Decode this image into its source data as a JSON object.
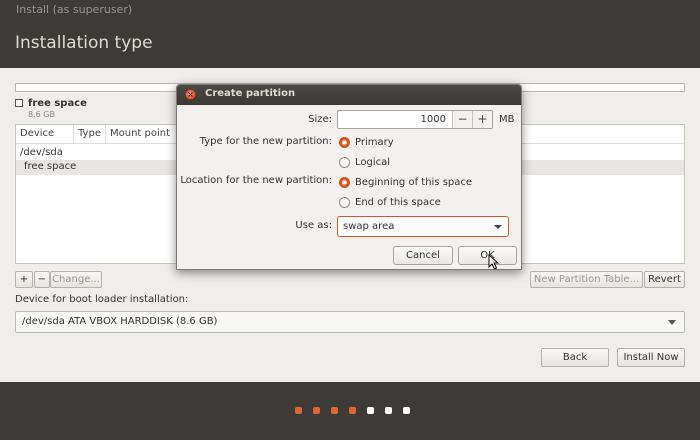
{
  "window": {
    "title": "Install (as superuser)",
    "page_title": "Installation type"
  },
  "disk_summary": {
    "label": "free space",
    "size": "8.6 GB"
  },
  "partition_table": {
    "columns": [
      "Device",
      "Type",
      "Mount point"
    ],
    "rows": [
      {
        "device": "/dev/sda"
      },
      {
        "device": "free space",
        "selected": true
      }
    ]
  },
  "table_actions": {
    "add": "+",
    "remove": "−",
    "change": "Change...",
    "new_table": "New Partition Table...",
    "revert": "Revert"
  },
  "boot_loader": {
    "label": "Device for boot loader installation:",
    "value": "/dev/sda ATA VBOX HARDDISK (8.6 GB)"
  },
  "nav": {
    "back": "Back",
    "install_now": "Install Now"
  },
  "progress": {
    "total": 7,
    "completed": 4,
    "active_color": "#e0662f",
    "inactive_color": "#ffffff"
  },
  "dialog": {
    "title": "Create partition",
    "close_icon": "close-icon",
    "size_label": "Size:",
    "size_value": "1000",
    "size_unit": "MB",
    "minus": "−",
    "plus": "+",
    "type_label": "Type for the new partition:",
    "type_options": [
      {
        "label": "Primary",
        "selected": true
      },
      {
        "label": "Logical",
        "selected": false
      }
    ],
    "location_label": "Location for the new partition:",
    "location_options": [
      {
        "label": "Beginning of this space",
        "selected": true
      },
      {
        "label": "End of this space",
        "selected": false
      }
    ],
    "use_as_label": "Use as:",
    "use_as_value": "swap area",
    "cancel": "Cancel",
    "ok": "OK"
  },
  "colors": {
    "accent": "#e0581f",
    "dark": "#3c3b37",
    "content_bg": "#efeeec"
  }
}
